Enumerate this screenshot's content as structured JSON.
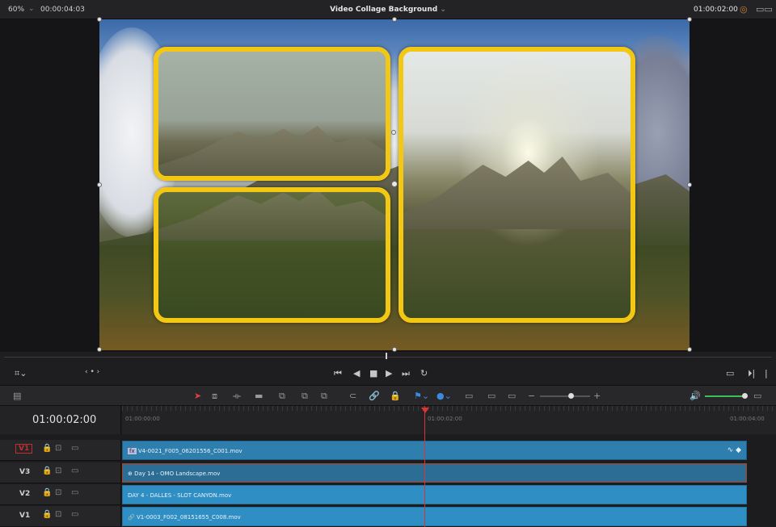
{
  "viewer": {
    "zoom": "60%",
    "source_timecode": "00:00:04:03",
    "title": "Video Collage Background",
    "record_timecode": "01:00:02:00"
  },
  "timeline": {
    "current_timecode": "01:00:02:00",
    "ruler_ticks": [
      "01:00:00:00",
      "01:00:02:00",
      "01:00:04:00"
    ],
    "tracks": [
      {
        "name": "V1",
        "clip": "V4-0021_F005_06201556_C001.mov",
        "highlighted": true
      },
      {
        "name": "V3",
        "clip": "Day 14 - OMO Landscape.mov"
      },
      {
        "name": "V2",
        "clip": "DAY 4 - DALLES - SLOT CANYON.mov"
      },
      {
        "name": "V1",
        "clip": "V1-0003_F002_08151655_C008.mov"
      }
    ]
  },
  "colors": {
    "collage_border": "#f2c814",
    "playhead": "#dd3333",
    "clip": "#2f8fc4"
  }
}
